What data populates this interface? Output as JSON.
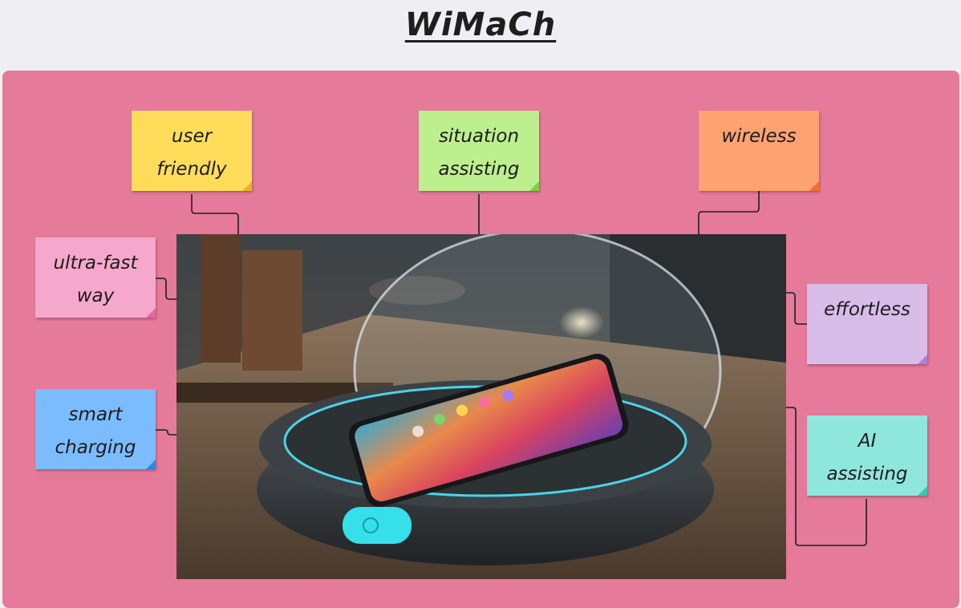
{
  "title": "WiMaCh",
  "colors": {
    "background": "#efeef2",
    "board": "#e67a9a",
    "connector": "#1e1e1e"
  },
  "notes": [
    {
      "id": "user-friendly",
      "lines": [
        "user",
        "friendly"
      ],
      "color": "#ffdd5a",
      "fold": "#e8b527"
    },
    {
      "id": "situation-assisting",
      "lines": [
        "situation",
        "assisting"
      ],
      "color": "#bdef8e",
      "fold": "#7fcf45"
    },
    {
      "id": "wireless",
      "lines": [
        "wireless"
      ],
      "color": "#ffa271",
      "fold": "#f0702d"
    },
    {
      "id": "ultra-fast-way",
      "lines": [
        "ultra-fast",
        "way"
      ],
      "color": "#f6a8cc",
      "fold": "#e765a2"
    },
    {
      "id": "effortless",
      "lines": [
        "effortless"
      ],
      "color": "#d8bde8",
      "fold": "#b07fd4"
    },
    {
      "id": "smart-charging",
      "lines": [
        "smart",
        "charging"
      ],
      "color": "#7bbcff",
      "fold": "#2e86ea"
    },
    {
      "id": "ai-assisting",
      "lines": [
        "AI",
        "assisting"
      ],
      "color": "#8fe6dc",
      "fold": "#38c7b8"
    }
  ],
  "image": {
    "subject": "smartphone on wireless charging pad"
  }
}
